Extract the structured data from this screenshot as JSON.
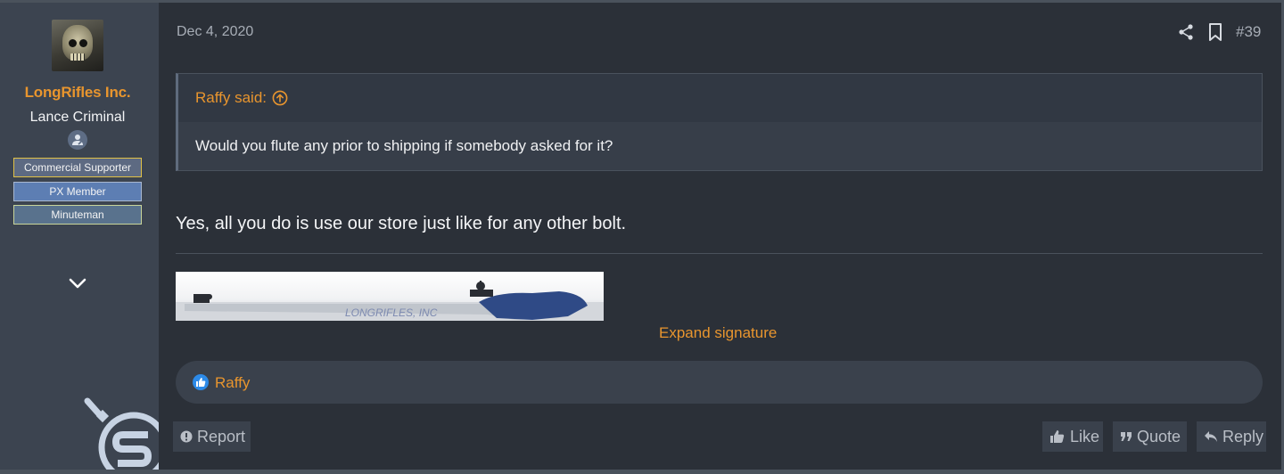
{
  "user": {
    "username": "LongRifles Inc.",
    "title": "Lance Criminal",
    "banners": [
      "Commercial Supporter",
      "PX Member",
      "Minuteman"
    ],
    "avatar_icon": "skull-avatar",
    "expand_icon": "chevron-down-icon"
  },
  "post": {
    "date": "Dec 4, 2020",
    "number": "#39",
    "quote": {
      "author_label": "Raffy said:",
      "text": "Would you flute any prior to shipping if somebody asked for it?"
    },
    "body": "Yes, all you do is use our store just like for any other bolt.",
    "signature": {
      "image_text": "LONGRIFLES, INC",
      "expand_label": "Expand signature"
    },
    "reactions": {
      "icon": "thumbs-up-icon",
      "users": "Raffy"
    }
  },
  "actions": {
    "report": "Report",
    "like": "Like",
    "quote": "Quote",
    "reply": "Reply"
  },
  "colors": {
    "accent": "#e8952e",
    "background": "#2b3038",
    "sidebar": "#3c4450",
    "like_blue": "#2c8ae8"
  }
}
